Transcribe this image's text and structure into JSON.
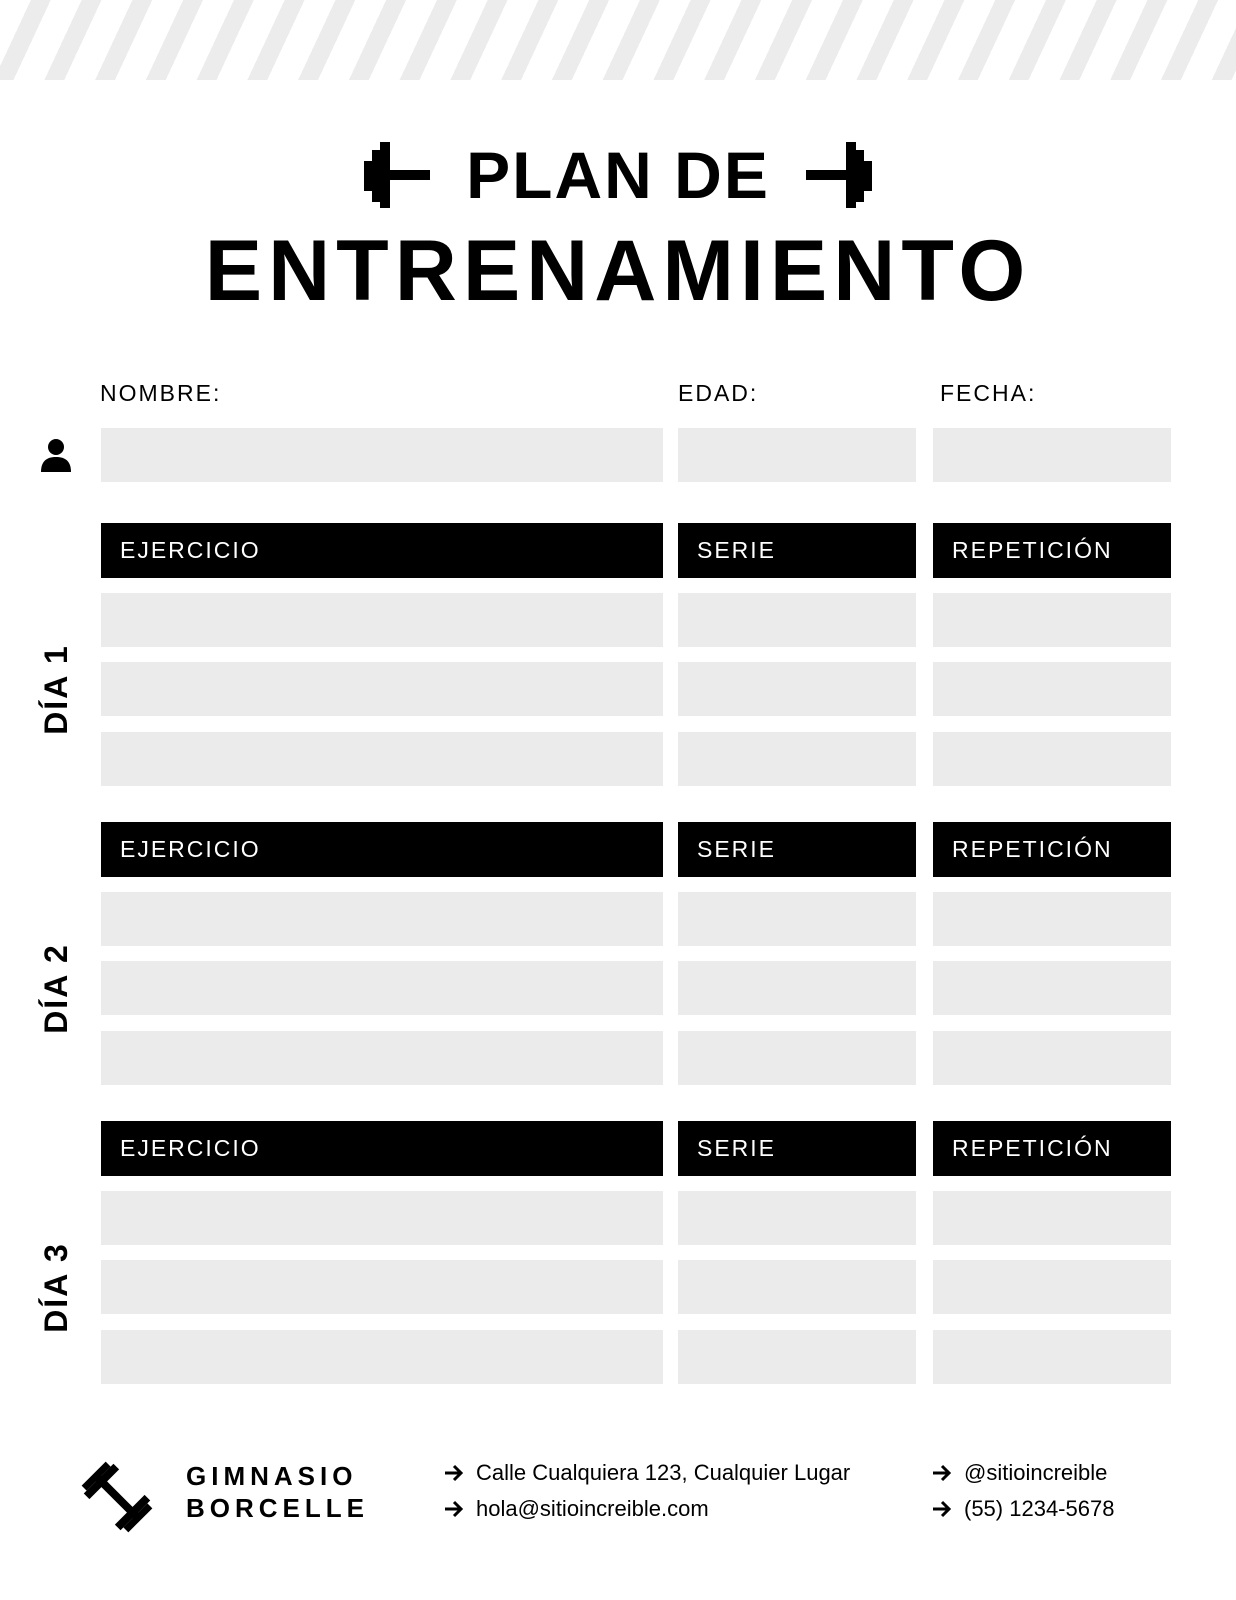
{
  "title": {
    "line1": "PLAN DE",
    "line2": "ENTRENAMIENTO"
  },
  "personal": {
    "name_label": "NOMBRE:",
    "age_label": "EDAD:",
    "date_label": "FECHA:"
  },
  "columns": {
    "exercise": "EJERCICIO",
    "sets": "SERIE",
    "reps": "REPETICIÓN"
  },
  "days": [
    "DÍA 1",
    "DÍA 2",
    "DÍA 3"
  ],
  "footer": {
    "brand_line1": "GIMNASIO",
    "brand_line2": "BORCELLE",
    "address": "Calle Cualquiera 123, Cualquier Lugar",
    "email": "hola@sitioincreible.com",
    "social": "@sitioincreible",
    "phone": "(55) 1234-5678"
  },
  "icons": {
    "title_left": "dumbbell-icon",
    "title_right": "dumbbell-icon",
    "person": "person-icon",
    "logo": "dumbbell-icon",
    "arrow": "arrow-right-icon"
  },
  "colors": {
    "ink": "#000000",
    "field": "#ebebeb",
    "stripe": "#ececec"
  }
}
